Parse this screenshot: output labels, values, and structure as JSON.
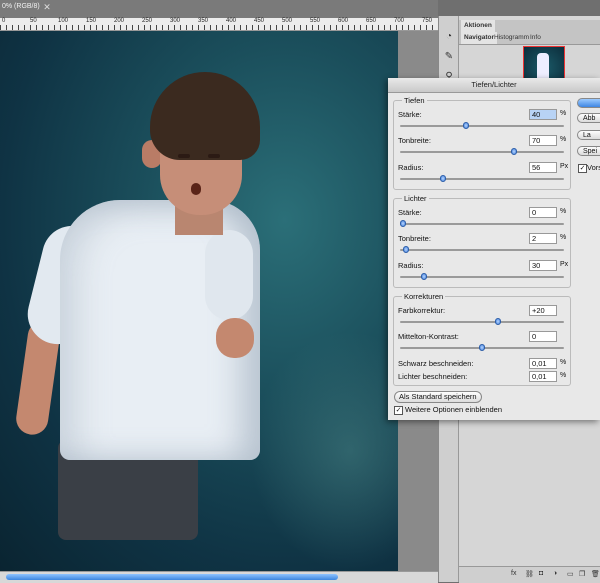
{
  "document": {
    "tab_title": "0% (RGB/8)",
    "ruler_marks": [
      "0",
      "50",
      "100",
      "150",
      "200",
      "250",
      "300",
      "350",
      "400",
      "450",
      "500",
      "550",
      "600",
      "650",
      "700",
      "750"
    ]
  },
  "panel": {
    "tabs_row1": [
      "Aktionen"
    ],
    "tabs_row2": [
      "Navigator",
      "Histogramm",
      "Info"
    ],
    "bottom_icons": [
      "fx"
    ]
  },
  "dialog": {
    "title": "Tiefen/Lichter",
    "tiefen": {
      "legend": "Tiefen",
      "staerke_label": "Stärke:",
      "staerke_value": "40",
      "staerke_unit": "%",
      "staerke_level": 0.4,
      "tonbreite_label": "Tonbreite:",
      "tonbreite_value": "70",
      "tonbreite_unit": "%",
      "tonbreite_level": 0.7,
      "radius_label": "Radius:",
      "radius_value": "56",
      "radius_unit": "Px",
      "radius_level": 0.25
    },
    "lichter": {
      "legend": "Lichter",
      "staerke_label": "Stärke:",
      "staerke_value": "0",
      "staerke_unit": "%",
      "staerke_level": 0.0,
      "tonbreite_label": "Tonbreite:",
      "tonbreite_value": "2",
      "tonbreite_unit": "%",
      "tonbreite_level": 0.02,
      "radius_label": "Radius:",
      "radius_value": "30",
      "radius_unit": "Px",
      "radius_level": 0.13
    },
    "korrekturen": {
      "legend": "Korrekturen",
      "farb_label": "Farbkorrektur:",
      "farb_value": "+20",
      "farb_level": 0.6,
      "mittel_label": "Mittelton-Kontrast:",
      "mittel_value": "0",
      "mittel_level": 0.5,
      "schwarz_label": "Schwarz beschneiden:",
      "schwarz_value": "0,01",
      "schwarz_unit": "%",
      "lichter_label": "Lichter beschneiden:",
      "lichter_value": "0,01",
      "lichter_unit": "%"
    },
    "save_default_label": "Als Standard speichern",
    "more_options_label": "Weitere Optionen einblenden",
    "more_options_checked": true,
    "side_buttons": [
      "OK",
      "Abb",
      "La",
      "Spei"
    ],
    "preview_label": "Vors",
    "preview_checked": true
  }
}
